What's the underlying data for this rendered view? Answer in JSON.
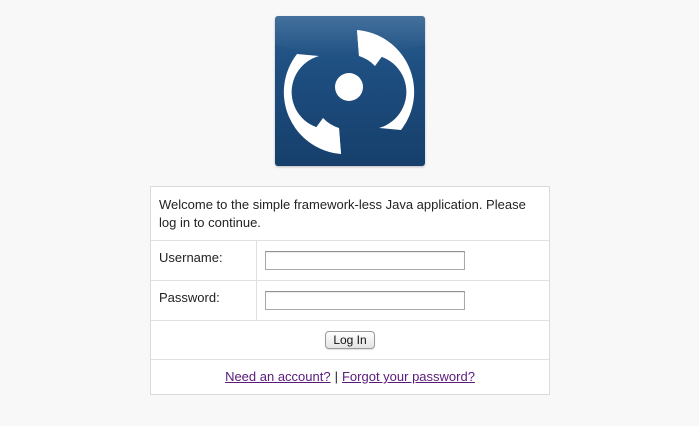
{
  "logo": {
    "icon": "hurricane-logo-icon",
    "colors": {
      "background": "#1d4d7f",
      "foreground": "#ffffff"
    }
  },
  "login": {
    "welcome_text": "Welcome to the simple framework-less Java application. Please log in to continue.",
    "username_label": "Username:",
    "username_value": "",
    "password_label": "Password:",
    "password_value": "",
    "login_button_label": "Log In",
    "need_account_link": "Need an account?",
    "separator": "|",
    "forgot_password_link": "Forgot your password?"
  },
  "colors": {
    "page_background": "#f8f8f8",
    "link": "#5a1a7a",
    "border": "#dadada"
  }
}
